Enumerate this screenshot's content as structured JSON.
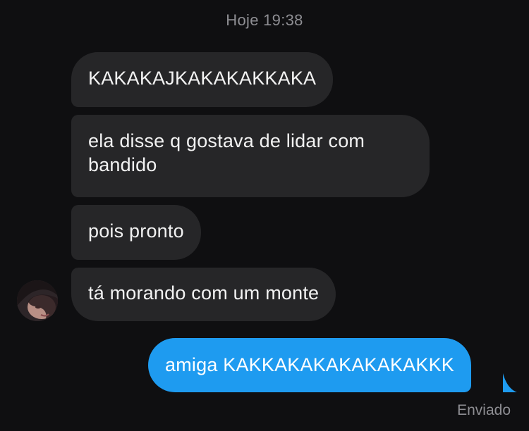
{
  "conversation": {
    "timestamp": "Hoje 19:38",
    "received": [
      {
        "text": "KAKAKAJKAKAKAKKAKA"
      },
      {
        "text": "ela disse q gostava de lidar com bandido"
      },
      {
        "text": "pois pronto"
      },
      {
        "text": "tá morando com um monte"
      }
    ],
    "sent": [
      {
        "text": "amiga KAKKAKAKAKAKAKAKKK",
        "status": "Enviado"
      }
    ]
  },
  "colors": {
    "background": "#0f0f11",
    "received_bubble": "#262628",
    "sent_bubble": "#1e9bf0",
    "muted_text": "#8e8e93"
  },
  "icons": {
    "avatar": "contact-avatar"
  }
}
